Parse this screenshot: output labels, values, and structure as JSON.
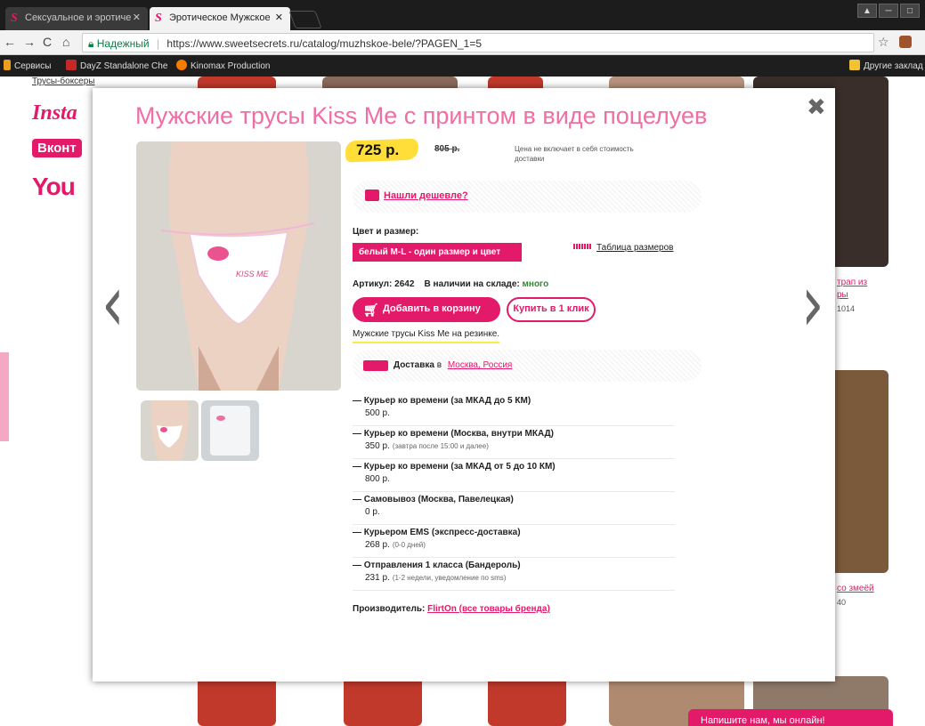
{
  "browser": {
    "tabs": [
      {
        "label": "Сексуальное и эротиче",
        "active": false
      },
      {
        "label": "Эротическое Мужское",
        "active": true
      }
    ],
    "address": {
      "secure_label": "Надежный",
      "url": "https://www.sweetsecrets.ru/catalog/muzhskoe-bele/?PAGEN_1=5"
    },
    "bookmarks": [
      "Сервисы",
      "DayZ Standalone Che",
      "Kinomax Production"
    ],
    "other_bookmarks": "Другие заклад"
  },
  "background": {
    "top_link": "Трусы-боксеры",
    "social": {
      "instagram": "Insta",
      "vk": "Вконт",
      "youtube": "You"
    },
    "right_links": [
      "трап из",
      "ры",
      "со змеёй"
    ],
    "right_codes": [
      "1014",
      "40"
    ],
    "chat": "Напишите нам, мы онлайн!"
  },
  "modal": {
    "title": "Мужские трусы Kiss Me с принтом в виде поцелуев",
    "price": "725 р.",
    "old_price": "805 р.",
    "price_note": "Цена не включает в себя стоимость доставки",
    "cheaper": "Нашли дешевле?",
    "size_label": "Цвет и размер:",
    "size_value": "белый M-L - один размер и цвет",
    "size_table": "Таблица размеров",
    "article_label": "Артикул:",
    "article_value": "2642",
    "stock_label": "В наличии на складе:",
    "stock_value": "много",
    "add_to_cart": "Добавить в корзину",
    "buy_one_click": "Купить в 1 клик",
    "short_description": "Мужские трусы Kiss Me на резинке.",
    "delivery_label": "Доставка",
    "delivery_in": "в",
    "delivery_city": "Москва, Россия",
    "shipping": [
      {
        "name": "— Курьер ко времени (за МКАД до 5 КМ)",
        "cost": "500 р.",
        "note": ""
      },
      {
        "name": "— Курьер ко времени (Москва, внутри МКАД)",
        "cost": "350 р.",
        "note": "(завтра после 15:00 и далее)"
      },
      {
        "name": "— Курьер ко времени (за МКАД от 5 до 10 КМ)",
        "cost": "800 р.",
        "note": ""
      },
      {
        "name": "— Самовывоз (Москва, Павелецкая)",
        "cost": "0 р.",
        "note": ""
      },
      {
        "name": "— Курьером EMS (экспресс-доставка)",
        "cost": "268 р.",
        "note": "(0-0 дней)"
      },
      {
        "name": "— Отправления 1 класса (Бандероль)",
        "cost": "231 р.",
        "note": "(1-2 недели, уведомление по sms)"
      }
    ],
    "maker_label": "Производитель:",
    "maker_link": "FlirtOn (все товары бренда)",
    "kiss_print": "KISS ME"
  },
  "colors": {
    "accent": "#e3196a",
    "title": "#f06ea3",
    "price_highlight": "#ffde3a",
    "stock": "#2e8b2e"
  }
}
